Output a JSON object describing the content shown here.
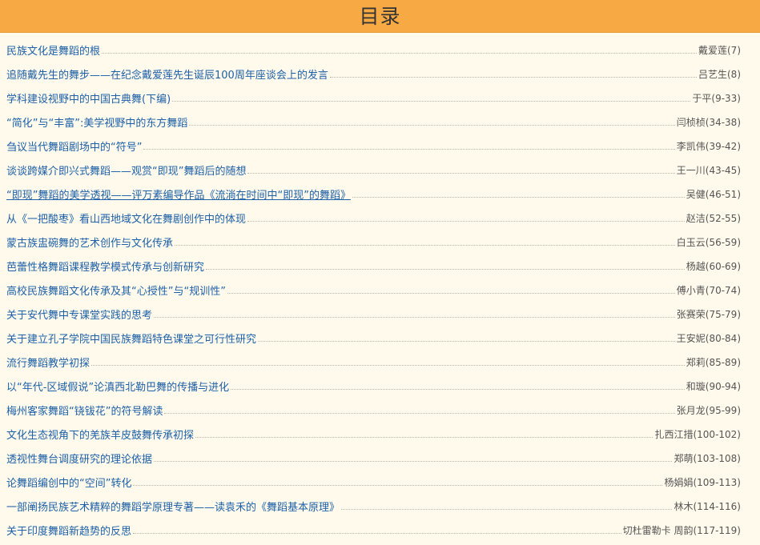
{
  "header": {
    "title": "目录"
  },
  "colors": {
    "header_bg": "#f7aa44",
    "page_bg": "#fffaec",
    "link": "#1d60a8"
  },
  "entries": [
    {
      "title": "民族文化是舞蹈的根",
      "author": "戴爱莲(7)"
    },
    {
      "title": "追随戴先生的舞步——在纪念戴爱莲先生诞辰100周年座谈会上的发言",
      "author": "吕艺生(8)"
    },
    {
      "title": "学科建设视野中的中国古典舞(下编)",
      "author": "于平(9-33)"
    },
    {
      "title": "“简化”与“丰富”:美学视野中的东方舞蹈",
      "author": "闫桢桢(34-38)"
    },
    {
      "title": "刍议当代舞蹈剧场中的“符号”",
      "author": "李凯伟(39-42)"
    },
    {
      "title": "谈谈跨媒介即兴式舞蹈——观赏“即现”舞蹈后的随想",
      "author": "王一川(43-45)"
    },
    {
      "title": "“即现”舞蹈的美学透视——评万素编导作品《流淌在时间中“即现”的舞蹈》",
      "author": "吴健(46-51)",
      "underlined": true
    },
    {
      "title": "从《一把酸枣》看山西地域文化在舞剧创作中的体现",
      "author": "赵洁(52-55)"
    },
    {
      "title": "蒙古族盅碗舞的艺术创作与文化传承",
      "author": "白玉云(56-59)"
    },
    {
      "title": "芭蕾性格舞蹈课程教学模式传承与创新研究",
      "author": "杨越(60-69)"
    },
    {
      "title": "高校民族舞蹈文化传承及其“心授性”与“规训性”",
      "author": "傅小青(70-74)"
    },
    {
      "title": "关于安代舞中专课堂实践的思考",
      "author": "张赛荣(75-79)"
    },
    {
      "title": "关于建立孔子学院中国民族舞蹈特色课堂之可行性研究",
      "author": "王安妮(80-84)"
    },
    {
      "title": "流行舞蹈教学初探",
      "author": "郑莉(85-89)"
    },
    {
      "title": "以“年代-区域假说”论滇西北勒巴舞的传播与进化",
      "author": "和璇(90-94)"
    },
    {
      "title": "梅州客家舞蹈“铙钹花”的符号解读",
      "author": "张月龙(95-99)"
    },
    {
      "title": "文化生态视角下的羌族羊皮鼓舞传承初探",
      "author": "扎西江措(100-102)"
    },
    {
      "title": "透视性舞台调度研究的理论依据",
      "author": "郑萌(103-108)"
    },
    {
      "title": "论舞蹈编创中的“空间”转化",
      "author": "杨娟娟(109-113)"
    },
    {
      "title": "一部阐扬民族艺术精粹的舞蹈学原理专著——读袁禾的《舞蹈基本原理》",
      "author": "林木(114-116)"
    },
    {
      "title": "关于印度舞蹈新趋势的反思",
      "author": "切杜雷勒卡 周韵(117-119)"
    }
  ]
}
